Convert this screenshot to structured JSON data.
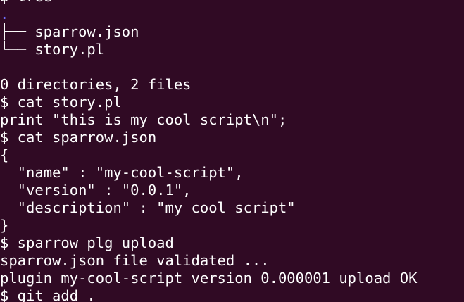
{
  "terminal": {
    "colors": {
      "background": "#300a24",
      "foreground": "#ffffff",
      "directory_dot": "#6f6fff"
    },
    "lines": [
      {
        "type": "command",
        "text": "$ tree"
      },
      {
        "type": "dir",
        "text": "."
      },
      {
        "type": "tree-entry",
        "text": "├── sparrow.json"
      },
      {
        "type": "tree-entry",
        "text": "└── story.pl"
      },
      {
        "type": "blank",
        "text": ""
      },
      {
        "type": "output",
        "text": "0 directories, 2 files"
      },
      {
        "type": "command",
        "text": "$ cat story.pl"
      },
      {
        "type": "output",
        "text": "print \"this is my cool script\\n\";"
      },
      {
        "type": "command",
        "text": "$ cat sparrow.json"
      },
      {
        "type": "output",
        "text": "{"
      },
      {
        "type": "output",
        "text": "  \"name\" : \"my-cool-script\","
      },
      {
        "type": "output",
        "text": "  \"version\" : \"0.0.1\","
      },
      {
        "type": "output",
        "text": "  \"description\" : \"my cool script\""
      },
      {
        "type": "output",
        "text": "}"
      },
      {
        "type": "command",
        "text": "$ sparrow plg upload"
      },
      {
        "type": "output",
        "text": "sparrow.json file validated ..."
      },
      {
        "type": "output",
        "text": "plugin my-cool-script version 0.000001 upload OK"
      },
      {
        "type": "command",
        "text": "$ git add ."
      }
    ]
  }
}
